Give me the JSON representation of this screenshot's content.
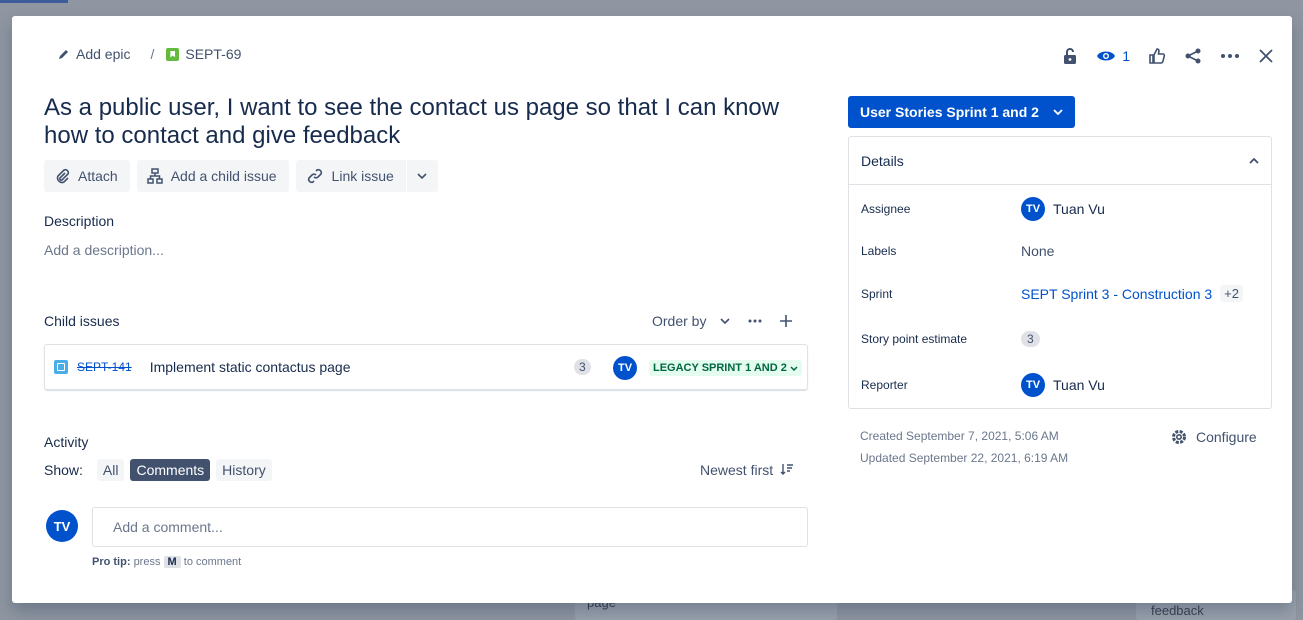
{
  "breadcrumb": {
    "add_epic": "Add epic",
    "separator": "/",
    "issue_key": "SEPT-69"
  },
  "toolbar": {
    "watch_count": "1"
  },
  "issue": {
    "title": "As a public user, I want to see the contact us page so that I can know how to contact and give feedback"
  },
  "actions": {
    "attach": "Attach",
    "add_child": "Add a child issue",
    "link_issue": "Link issue"
  },
  "description": {
    "label": "Description",
    "placeholder": "Add a description..."
  },
  "child_issues": {
    "label": "Child issues",
    "order_by": "Order by",
    "items": [
      {
        "key": "SEPT-141",
        "summary": "Implement static contactus page",
        "story_points": "3",
        "assignee_initials": "TV",
        "status": "LEGACY SPRINT 1 AND 2"
      }
    ]
  },
  "activity": {
    "label": "Activity",
    "show_label": "Show:",
    "filters": [
      "All",
      "Comments",
      "History"
    ],
    "active_filter": "Comments",
    "sort": "Newest first"
  },
  "comment": {
    "avatar_initials": "TV",
    "placeholder": "Add a comment...",
    "pro_tip_label": "Pro tip:",
    "pro_tip_pre": "press",
    "pro_tip_key": "M",
    "pro_tip_post": "to comment"
  },
  "sprint_button": {
    "label": "User Stories Sprint 1 and 2"
  },
  "details": {
    "header": "Details",
    "assignee_label": "Assignee",
    "assignee_initials": "TV",
    "assignee_name": "Tuan Vu",
    "labels_label": "Labels",
    "labels_value": "None",
    "sprint_label": "Sprint",
    "sprint_value": "SEPT Sprint 3 - Construction 3",
    "sprint_more": "+2",
    "story_point_label": "Story point estimate",
    "story_point_value": "3",
    "reporter_label": "Reporter",
    "reporter_initials": "TV",
    "reporter_name": "Tuan Vu"
  },
  "meta": {
    "created": "Created September 7, 2021, 5:06 AM",
    "updated": "Updated September 22, 2021, 6:19 AM",
    "configure": "Configure"
  },
  "background": {
    "fragment_1": "page",
    "fragment_2": "feedback"
  },
  "colors": {
    "primary": "#0052cc",
    "story": "#63ba3c",
    "subtask": "#4bade8",
    "done_status": "#006644"
  }
}
